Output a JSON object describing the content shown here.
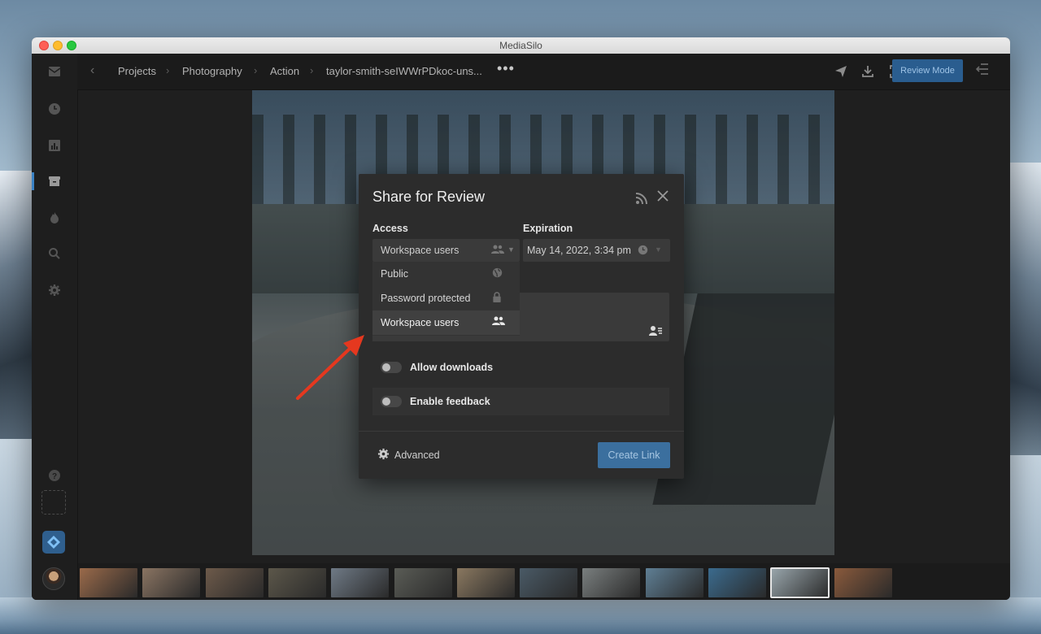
{
  "window": {
    "title": "MediaSilo"
  },
  "topbar": {
    "breadcrumb": [
      "Projects",
      "Photography",
      "Action",
      "taylor-smith-seIWWrPDkoc-uns..."
    ],
    "more": "•••",
    "review_mode_label": "Review Mode"
  },
  "modal": {
    "title": "Share for Review",
    "access_label": "Access",
    "access_value": "Workspace users",
    "expiration_label": "Expiration",
    "expiration_value": "May 14, 2022, 3:34 pm",
    "access_options": [
      {
        "label": "Public",
        "icon": "globe-icon"
      },
      {
        "label": "Password protected",
        "icon": "lock-icon"
      },
      {
        "label": "Workspace users",
        "icon": "users-icon",
        "selected": true
      }
    ],
    "allow_downloads_label": "Allow downloads",
    "allow_downloads_on": false,
    "enable_feedback_label": "Enable feedback",
    "enable_feedback_on": false,
    "advanced_label": "Advanced",
    "create_link_label": "Create Link"
  },
  "colors": {
    "accent": "#2a5d8f",
    "annotation_arrow": "#e5381f"
  },
  "filmstrip": {
    "thumb_colors": [
      "#9a6a4a",
      "#8a7462",
      "#6d5a4a",
      "#5c574a",
      "#6f7a86",
      "#5a5c56",
      "#8a7860",
      "#4a5a66",
      "#7a7f7f",
      "#5f7f95",
      "#3b6b8e",
      "#9aa7ad",
      "#8a5a3c"
    ],
    "selected_index": 11
  }
}
